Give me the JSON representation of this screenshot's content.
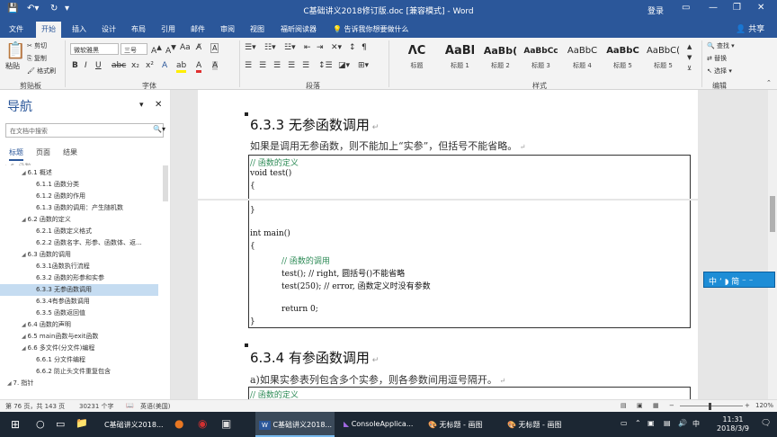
{
  "app": {
    "title": "C基础讲义2018修订版.doc [兼容模式] - Word",
    "login": "登录",
    "share": "共享",
    "win_min": "—",
    "win_restore": "❐",
    "win_close": "✕"
  },
  "ribbon_tabs": [
    "文件",
    "开始",
    "插入",
    "设计",
    "布局",
    "引用",
    "邮件",
    "审阅",
    "视图",
    "福昕阅读器"
  ],
  "tell_me": "告诉我你想要做什么",
  "ribbon": {
    "paste": "粘贴",
    "cut": "剪切",
    "copy": "复制",
    "format_painter": "格式刷",
    "font_name": "微软雅黑",
    "font_size": "三号",
    "groups": {
      "clipboard": "剪贴板",
      "font": "字体",
      "paragraph": "段落",
      "styles": "样式",
      "editing": "编辑"
    },
    "styles": [
      {
        "preview": "ᐱC",
        "name": "标题"
      },
      {
        "preview": "AaBl",
        "name": "标题 1"
      },
      {
        "preview": "AaBb(",
        "name": "标题 2"
      },
      {
        "preview": "AaBbCc",
        "name": "标题 3"
      },
      {
        "preview": "AaBbC",
        "name": "标题 4"
      },
      {
        "preview": "AaBbC",
        "name": "标题 5"
      },
      {
        "preview": "AaBbC(",
        "name": "标题 5"
      }
    ],
    "find": "查找",
    "replace": "替换",
    "select": "选择"
  },
  "nav": {
    "title": "导航",
    "search_placeholder": "在文档中搜索",
    "tabs": [
      "标题",
      "页面",
      "结果"
    ],
    "items": [
      {
        "label": "6.1 概述",
        "level": 2
      },
      {
        "label": "6.1.1 函数分类",
        "level": 3
      },
      {
        "label": "6.1.2 函数的作用",
        "level": 3
      },
      {
        "label": "6.1.3 函数的调用：产生随机数",
        "level": 3
      },
      {
        "label": "6.2 函数的定义",
        "level": 2
      },
      {
        "label": "6.2.1 函数定义格式",
        "level": 3
      },
      {
        "label": "6.2.2 函数名字、形参、函数体、返...",
        "level": 3
      },
      {
        "label": "6.3 函数的调用",
        "level": 2
      },
      {
        "label": "6.3.1函数执行流程",
        "level": 3
      },
      {
        "label": "6.3.2 函数的形参和实参",
        "level": 3
      },
      {
        "label": "6.3.3 无参函数调用",
        "level": 3,
        "selected": true
      },
      {
        "label": "6.3.4有参函数调用",
        "level": 3
      },
      {
        "label": "6.3.5 函数返回值",
        "level": 3
      },
      {
        "label": "6.4 函数的声明",
        "level": 2
      },
      {
        "label": "6.5 main函数与exit函数",
        "level": 2
      },
      {
        "label": "6.6 多文件(分文件)编程",
        "level": 2
      },
      {
        "label": "6.6.1 分文件编程",
        "level": 3
      },
      {
        "label": "6.6.2 防止头文件重复包含",
        "level": 3
      },
      {
        "label": "7. 指针",
        "level": 1
      }
    ]
  },
  "doc": {
    "h_633": "6.3.3 无参函数调用",
    "p1": "如果是调用无参函数，则不能加上“实参”，但括号不能省略。",
    "code1": [
      "// 函数的定义",
      "void test()",
      "{",
      "}",
      "int main()",
      "{",
      "// 函数的调用",
      "test();   // right, 圆括号()不能省略",
      "test(250); // error, 函数定义时没有参数",
      "return 0;",
      "}"
    ],
    "h_634": "6.3.4 有参函数调用",
    "p2": "a)如果实参表列包含多个实参，则各参数间用逗号隔开。",
    "code2_first": "// 函数的定义"
  },
  "ime": "中 ’ ◗ 简 ⁻ ⁻",
  "status": {
    "page": "第 76 页，共 143 页",
    "words": "30231 个字",
    "lang": "英语(美国)",
    "zoom": "120%"
  },
  "taskbar": {
    "search": "",
    "items": [
      {
        "label": "C基础讲义2018..."
      },
      {
        "label": "C基础讲义2018...",
        "active": true
      },
      {
        "label": "ConsoleApplica..."
      },
      {
        "label": "无标题 - 画图"
      },
      {
        "label": "无标题 - 画图"
      }
    ],
    "time": "11:31",
    "date": "2018/3/9"
  }
}
